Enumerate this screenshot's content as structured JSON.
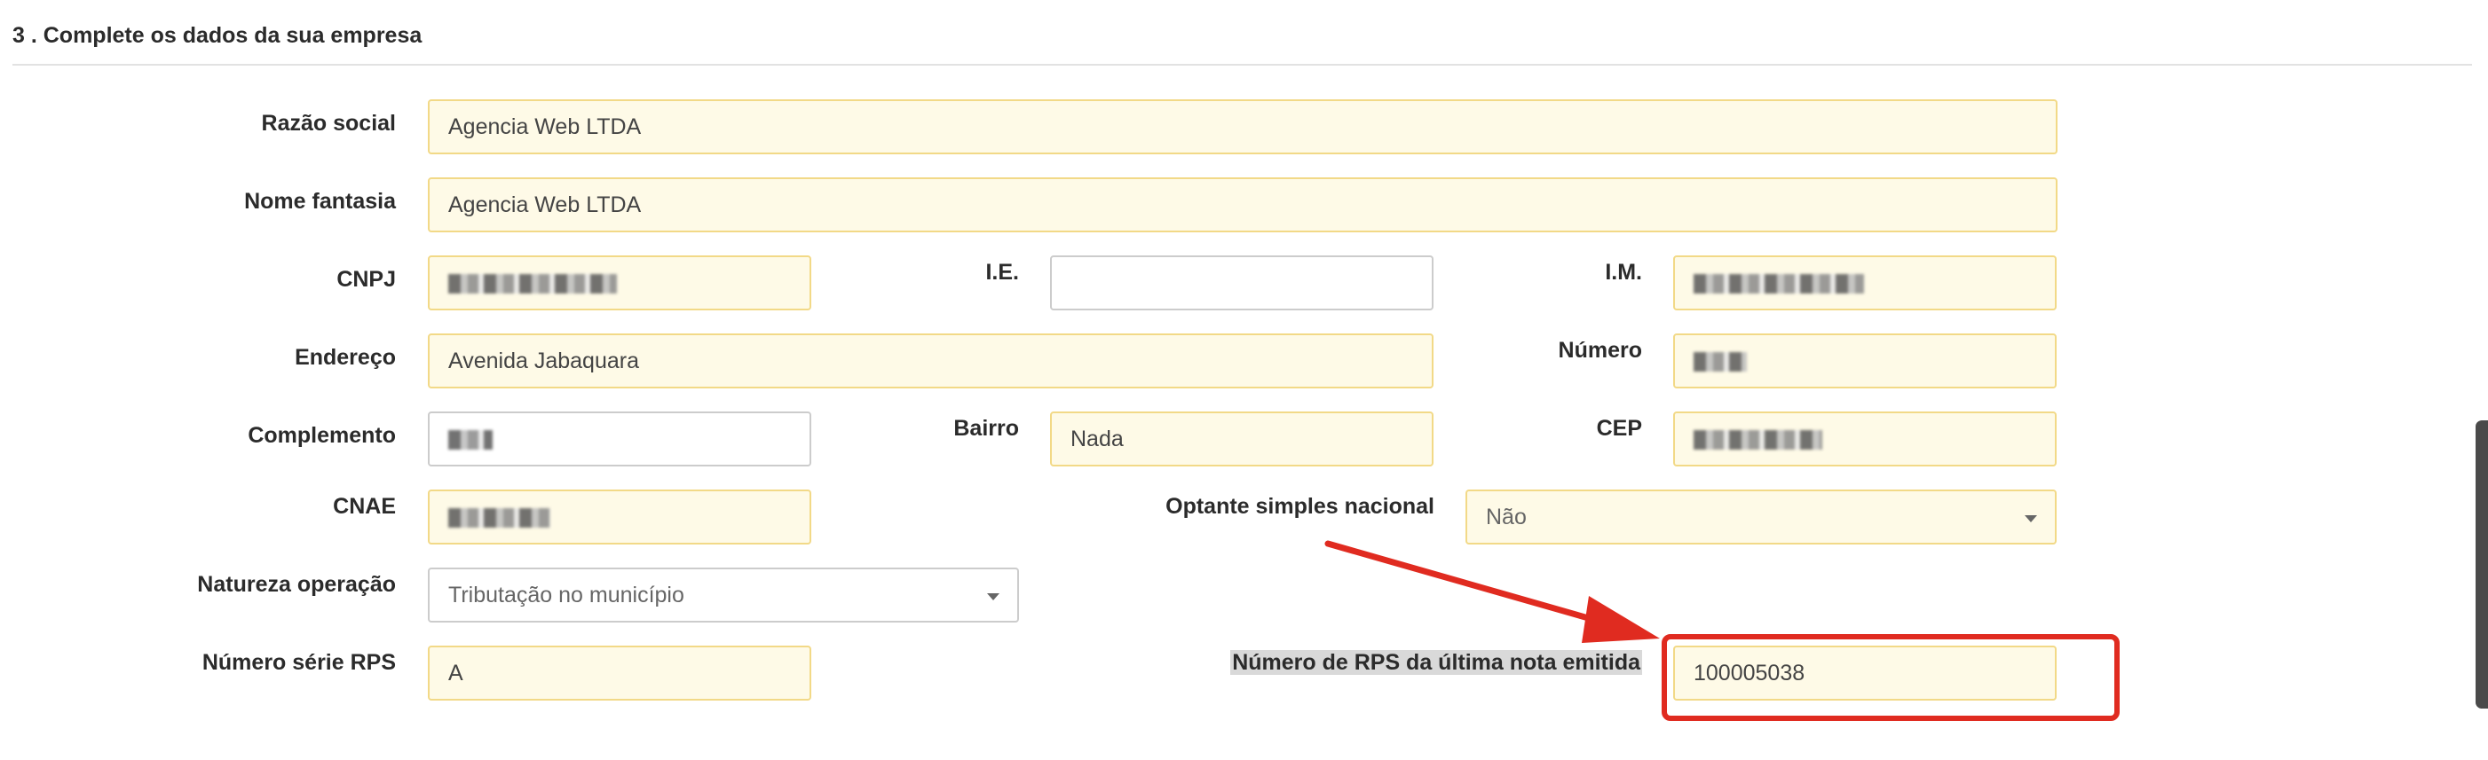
{
  "section": {
    "title": "3 . Complete os dados da sua empresa"
  },
  "fields": {
    "razao_social": {
      "label": "Razão social",
      "value": "Agencia Web LTDA"
    },
    "nome_fantasia": {
      "label": "Nome fantasia",
      "value": "Agencia Web LTDA"
    },
    "cnpj": {
      "label": "CNPJ"
    },
    "ie": {
      "label": "I.E.",
      "value": ""
    },
    "im": {
      "label": "I.M."
    },
    "endereco": {
      "label": "Endereço",
      "value": "Avenida Jabaquara"
    },
    "numero": {
      "label": "Número"
    },
    "complemento": {
      "label": "Complemento"
    },
    "bairro": {
      "label": "Bairro",
      "value": "Nada"
    },
    "cep": {
      "label": "CEP"
    },
    "cnae": {
      "label": "CNAE"
    },
    "optante": {
      "label": "Optante simples nacional",
      "value": "Não"
    },
    "natureza": {
      "label": "Natureza operação",
      "value": "Tributação no município"
    },
    "serie_rps": {
      "label": "Número série RPS",
      "value": "A"
    },
    "ultima_rps": {
      "label": "Número de RPS da última nota emitida",
      "value": "100005038"
    }
  },
  "colors": {
    "field_background": "#fefae7",
    "field_border": "#f2d987",
    "annotation_red": "#e02b20"
  }
}
